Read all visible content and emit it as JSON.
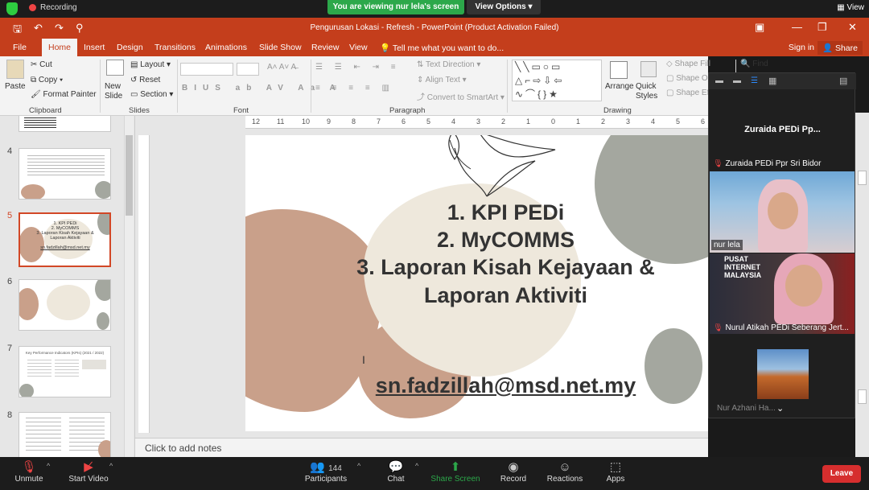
{
  "zoom_top": {
    "recording": "Recording",
    "banner": "You are viewing nur lela's screen",
    "view_options": "View Options",
    "view": "View"
  },
  "ppt": {
    "title": "Pengurusan Lokasi - Refresh - PowerPoint (Product Activation Failed)",
    "tabs": [
      "File",
      "Home",
      "Insert",
      "Design",
      "Transitions",
      "Animations",
      "Slide Show",
      "Review",
      "View"
    ],
    "tell_me": "Tell me what you want to do...",
    "sign_in": "Sign in",
    "share": "Share"
  },
  "ribbon": {
    "paste": "Paste",
    "cut": "Cut",
    "copy": "Copy",
    "format_painter": "Format Painter",
    "clipboard": "Clipboard",
    "new_slide": "New Slide",
    "layout": "Layout",
    "reset": "Reset",
    "section": "Section",
    "slides": "Slides",
    "font": "Font",
    "text_direction": "Text Direction",
    "align_text": "Align Text",
    "convert_smartart": "Convert to SmartArt",
    "paragraph": "Paragraph",
    "arrange": "Arrange",
    "quick_styles": "Quick Styles",
    "shape_fill": "Shape Fill",
    "shape_outline": "Shape Ou",
    "shape_effects": "Shape Ef",
    "drawing": "Drawing",
    "find": "Find"
  },
  "thumbs": {
    "numbers": [
      "4",
      "5",
      "6",
      "7",
      "8"
    ],
    "slide5_lines": [
      "1. KPI PEDi",
      "2. MyCOMMS",
      "3. Laporan Kisah Kejayaan &",
      "Laporan Aktiviti",
      "sn.fadzillah@msd.net.my"
    ],
    "slide7_title": "Key Performance Indicators (KPIs) (2021 / 2022)"
  },
  "slide": {
    "line1": "1. KPI PEDi",
    "line2": "2. MyCOMMS",
    "line3": "3. Laporan Kisah Kejayaan &",
    "line4": "Laporan Aktiviti",
    "email": "sn.fadzillah@msd.net.my"
  },
  "notes": "Click to add notes",
  "ruler_numbers": [
    "12",
    "11",
    "10",
    "9",
    "8",
    "7",
    "6",
    "5",
    "4",
    "3",
    "2",
    "1",
    "0",
    "1",
    "2",
    "3",
    "4",
    "5",
    "6"
  ],
  "participants_panel": {
    "header_name": "Zuraida PEDi Pp...",
    "p1": "Zuraida PEDi Ppr Sri Bidor",
    "p2": "nur lela",
    "p3": "Nurul Atikah PEDi Seberang Jert...",
    "p3_bg_text": "PUSAT INTERNET MALAYSIA",
    "p4": "Nur Azhani Ha..."
  },
  "zoom_bar": {
    "unmute": "Unmute",
    "start_video": "Start Video",
    "participants": "Participants",
    "participant_count": "144",
    "chat": "Chat",
    "share_screen": "Share Screen",
    "record": "Record",
    "reactions": "Reactions",
    "apps": "Apps",
    "leave": "Leave"
  },
  "colors": {
    "ppt_accent": "#c43e1c",
    "zoom_banner": "#2ca84a",
    "leave": "#d62e2e",
    "blob_brown": "#c9a08a",
    "blob_beige": "#eee8dc",
    "blob_grey": "#a4a79f"
  }
}
